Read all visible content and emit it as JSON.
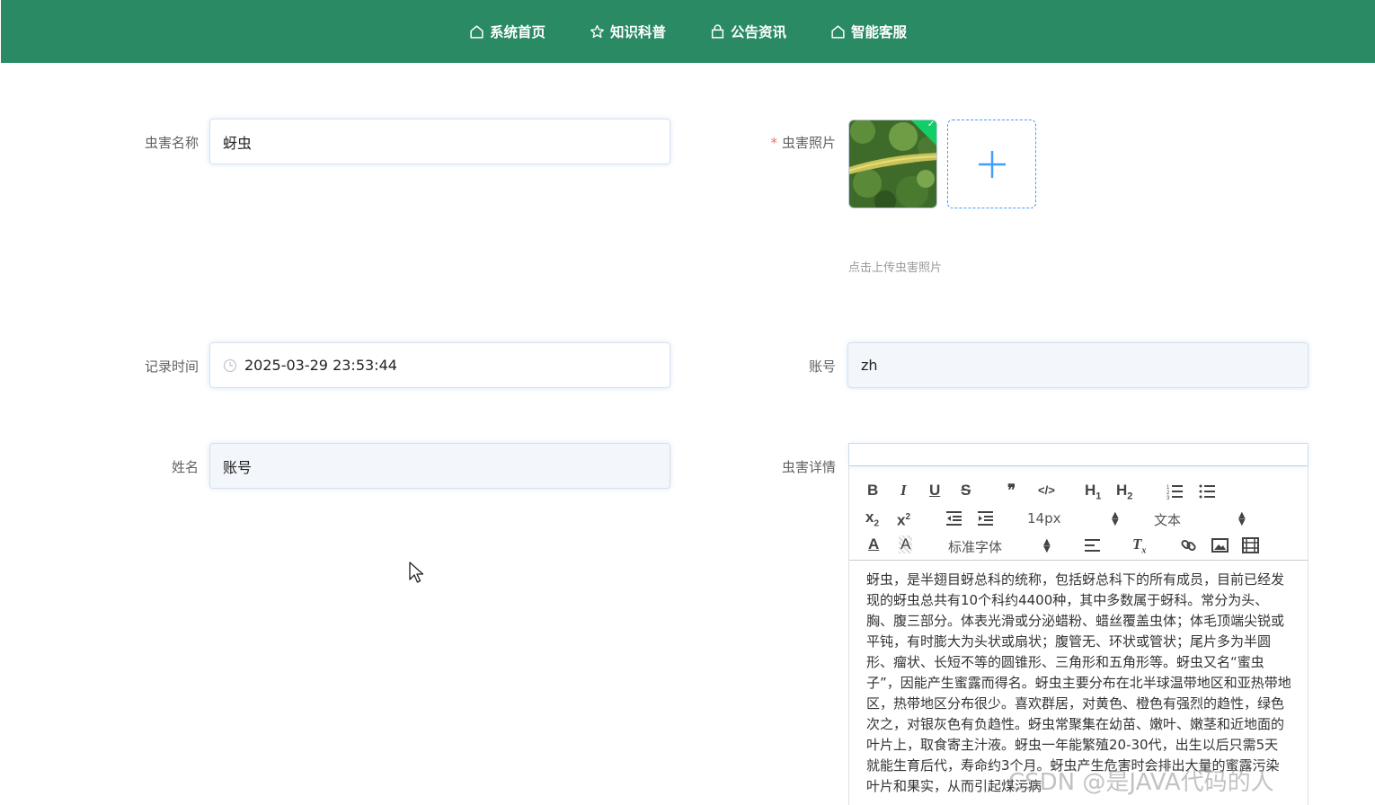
{
  "nav": {
    "items": [
      {
        "label": "系统首页",
        "icon": "home-icon"
      },
      {
        "label": "知识科普",
        "icon": "star-icon"
      },
      {
        "label": "公告资讯",
        "icon": "bag-icon"
      },
      {
        "label": "智能客服",
        "icon": "home-icon"
      }
    ]
  },
  "form": {
    "pest_name_label": "虫害名称",
    "pest_name_value": "蚜虫",
    "photo_label": "虫害照片",
    "photo_tip": "点击上传虫害照片",
    "record_time_label": "记录时间",
    "record_time_value": "2025-03-29 23:53:44",
    "account_label": "账号",
    "account_value": "zh",
    "name_label": "姓名",
    "name_value": "账号",
    "detail_label": "虫害详情"
  },
  "editor": {
    "font_size": "14px",
    "header_select": "文本",
    "font_family": "标准字体",
    "content": "蚜虫，是半翅目蚜总科的统称，包括蚜总科下的所有成员，目前已经发现的蚜虫总共有10个科约4400种，其中多数属于蚜科。常分为头、胸、腹三部分。体表光滑或分泌蜡粉、蜡丝覆盖虫体；体毛顶端尖锐或平钝，有时膨大为头状或扇状；腹管无、环状或管状；尾片多为半圆形、瘤状、长短不等的圆锥形、三角形和五角形等。蚜虫又名“蜜虫子”，因能产生蜜露而得名。蚜虫主要分布在北半球温带地区和亚热带地区，热带地区分布很少。喜欢群居，对黄色、橙色有强烈的趋性，绿色次之，对银灰色有负趋性。蚜虫常聚集在幼苗、嫩叶、嫩茎和近地面的叶片上，取食寄主汁液。蚜虫一年能繁殖20-30代，出生以后只需5天就能生育后代，寿命约3个月。蚜虫产生危害时会排出大量的蜜露污染叶片和果实，从而引起煤污病"
  },
  "watermark": "CSDN @是JAVA代码的人",
  "colors": {
    "nav_bg": "#2a8a64",
    "required": "#f56c6c",
    "accent": "#409eff",
    "success": "#13ce66"
  }
}
